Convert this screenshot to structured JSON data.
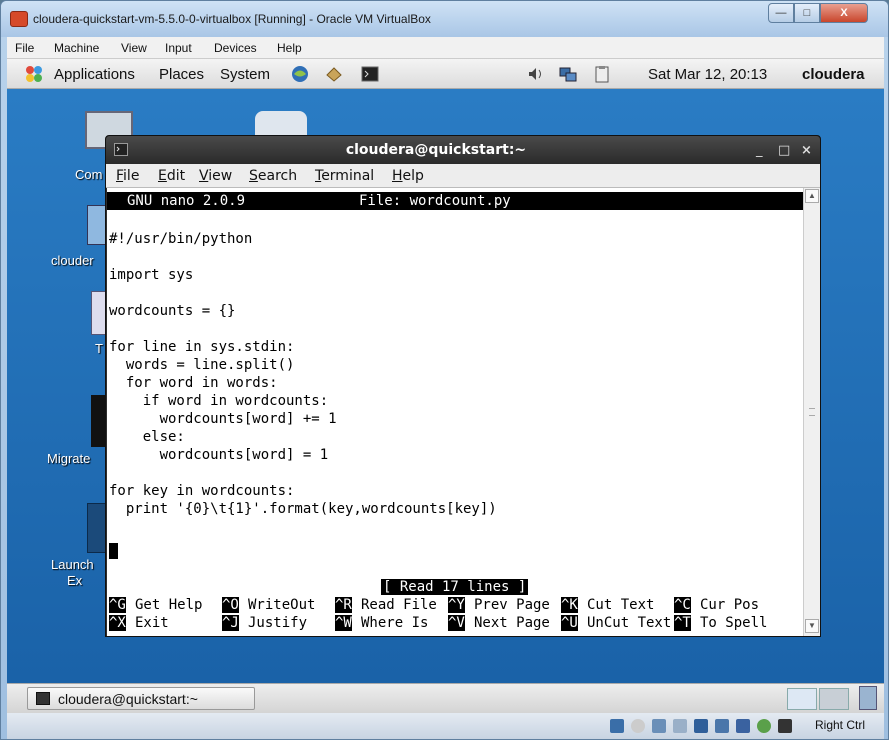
{
  "host_window": {
    "title": "cloudera-quickstart-vm-5.5.0-0-virtualbox [Running] - Oracle VM VirtualBox",
    "controls": {
      "minimize": "—",
      "maximize": "□",
      "close": "X"
    },
    "menu": [
      "File",
      "Machine",
      "View",
      "Input",
      "Devices",
      "Help"
    ],
    "host_key": "Right Ctrl"
  },
  "guest_panel": {
    "menus": [
      "Applications",
      "Places",
      "System"
    ],
    "clock": "Sat Mar 12, 20:13",
    "user": "cloudera"
  },
  "desktop": {
    "icons": [
      "Com",
      "clouder",
      "T",
      "Migrate",
      "Launch",
      "Ex"
    ]
  },
  "terminal": {
    "title": "cloudera@quickstart:~",
    "controls": {
      "minimize": "_",
      "maximize": "□",
      "close": "×"
    },
    "menu": [
      {
        "mnemonic": "F",
        "rest": "ile"
      },
      {
        "mnemonic": "E",
        "rest": "dit"
      },
      {
        "mnemonic": "V",
        "rest": "iew"
      },
      {
        "mnemonic": "S",
        "rest": "earch"
      },
      {
        "mnemonic": "T",
        "rest": "erminal"
      },
      {
        "mnemonic": "H",
        "rest": "elp"
      }
    ]
  },
  "nano": {
    "version": "GNU nano 2.0.9",
    "file": "File: wordcount.py",
    "lines": [
      "",
      "#!/usr/bin/python",
      "",
      "import sys",
      "",
      "wordcounts = {}",
      "",
      "for line in sys.stdin:",
      "  words = line.split()",
      "  for word in words:",
      "    if word in wordcounts:",
      "      wordcounts[word] += 1",
      "    else:",
      "      wordcounts[word] = 1",
      "",
      "for key in wordcounts:",
      "  print '{0}\\t{1}'.format(key,wordcounts[key])"
    ],
    "status": "[ Read 17 lines ]",
    "shortcuts_row1": [
      {
        "key": "^G",
        "label": "Get Help"
      },
      {
        "key": "^O",
        "label": "WriteOut"
      },
      {
        "key": "^R",
        "label": "Read File"
      },
      {
        "key": "^Y",
        "label": "Prev Page"
      },
      {
        "key": "^K",
        "label": "Cut Text"
      },
      {
        "key": "^C",
        "label": "Cur Pos"
      }
    ],
    "shortcuts_row2": [
      {
        "key": "^X",
        "label": "Exit"
      },
      {
        "key": "^J",
        "label": "Justify"
      },
      {
        "key": "^W",
        "label": "Where Is"
      },
      {
        "key": "^V",
        "label": "Next Page"
      },
      {
        "key": "^U",
        "label": "UnCut Text"
      },
      {
        "key": "^T",
        "label": "To Spell"
      }
    ]
  },
  "taskbar": {
    "task": "cloudera@quickstart:~"
  },
  "colors": {
    "desktop": "#2a7cc4",
    "terminal_title": "#2e2e2e",
    "nano_bar": "#000000"
  }
}
